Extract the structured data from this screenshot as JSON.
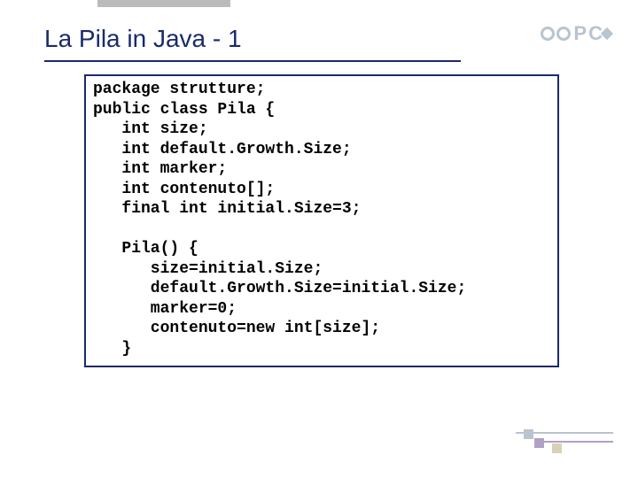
{
  "title": "La Pila in Java - 1",
  "logo": {
    "p": "P",
    "c": "C"
  },
  "code": "package strutture;\npublic class Pila {\n   int size;\n   int default.Growth.Size;\n   int marker;\n   int contenuto[];\n   final int initial.Size=3;\n\n   Pila() {\n      size=initial.Size;\n      default.Growth.Size=initial.Size;\n      marker=0;\n      contenuto=new int[size];\n   }"
}
